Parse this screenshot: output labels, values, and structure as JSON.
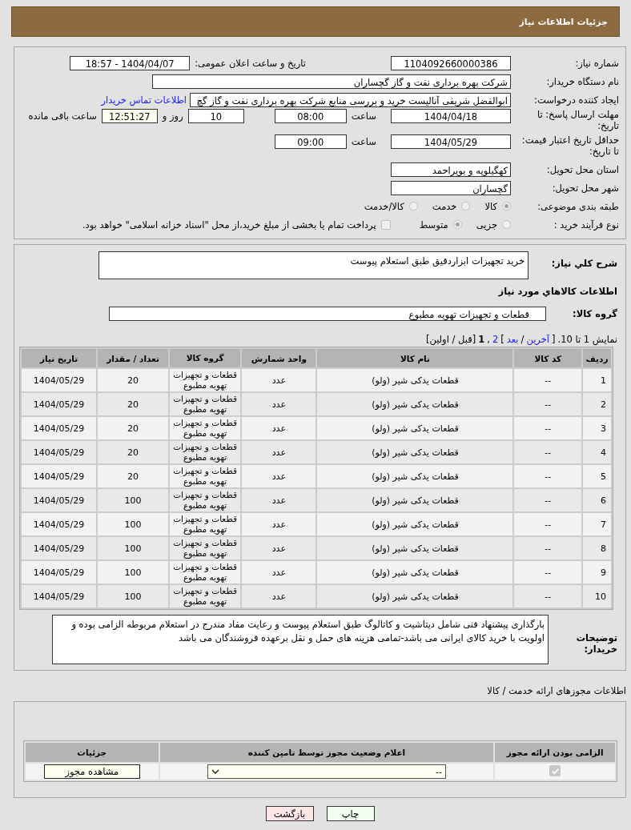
{
  "header": {
    "title": "جزئیات اطلاعات نیاز"
  },
  "form": {
    "need_number": {
      "label": "شماره نیاز:",
      "value": "1104092660000386"
    },
    "announce": {
      "label": "تاریخ و ساعت اعلان عمومی:",
      "value": "1404/04/07 - 18:57"
    },
    "buyer": {
      "label": "نام دستگاه خریدار:",
      "value": "شرکت بهره برداری نفت و گاز گچساران"
    },
    "creator": {
      "label": "ایجاد کننده درخواست:",
      "value": "ابوالفضل شریفی آنالیست خرید و بررسی منابع شرکت بهره برداری نفت و گاز گچ",
      "link": "اطلاعات تماس خریدار"
    },
    "deadline": {
      "label": "مهلت ارسال پاسخ: تا تاریخ:",
      "date": "1404/04/18",
      "time_label": "ساعت",
      "time": "08:00",
      "days": "10",
      "days_label": "روز و",
      "remaining": "12:51:27",
      "remaining_label": "ساعت باقی مانده"
    },
    "validity": {
      "label": "حداقل تاریخ اعتبار قیمت: تا تاریخ:",
      "date": "1404/05/29",
      "time_label": "ساعت",
      "time": "09:00"
    },
    "province": {
      "label": "استان محل تحویل:",
      "value": "کهگیلویه و بویراحمد"
    },
    "city": {
      "label": "شهر محل تحویل:",
      "value": "گچساران"
    },
    "category": {
      "label": "طبقه بندی موضوعی:",
      "options": [
        {
          "label": "کالا",
          "selected": true
        },
        {
          "label": "خدمت",
          "selected": false
        },
        {
          "label": "کالا/خدمت",
          "selected": false
        }
      ]
    },
    "process": {
      "label": "نوع فرآیند خرید :",
      "options": [
        {
          "label": "جزیی",
          "selected": false
        },
        {
          "label": "متوسط",
          "selected": true
        }
      ],
      "payment": {
        "label": "پرداخت تمام یا بخشی از مبلغ خرید،از محل \"اسناد خزانه اسلامی\" خواهد بود.",
        "checked": false
      }
    }
  },
  "summary": {
    "label": "شرح کلي نياز:",
    "value": "خرید تجهیزات ابزاردقیق طبق استعلام پیوست"
  },
  "goods_title": "اطلاعات کالاهاي مورد نياز",
  "goods_group": {
    "label": "گروه کالا:",
    "value": "قطعات و تجهیزات تهویه مطبوع"
  },
  "pagination": [
    {
      "kind": "text",
      "text": "نمایش 1 تا 10."
    },
    {
      "kind": "text",
      "text": "["
    },
    {
      "kind": "link",
      "text": "آخرین"
    },
    {
      "kind": "text",
      "text": "/"
    },
    {
      "kind": "link",
      "text": "بعد"
    },
    {
      "kind": "text",
      "text": "]"
    },
    {
      "kind": "link",
      "text": "2"
    },
    {
      "kind": "text",
      "text": ","
    },
    {
      "kind": "current",
      "text": "1"
    },
    {
      "kind": "text",
      "text": "[قبل / اولین]"
    }
  ],
  "table": {
    "columns": [
      "ردیف",
      "کد کالا",
      "نام کالا",
      "واحد شمارش",
      "گروه کالا",
      "تعداد / مقدار",
      "تاریخ نیاز"
    ],
    "rows": [
      [
        "1",
        "--",
        "قطعات یدکی شیر (ولو)",
        "عدد",
        "قطعات و تجهیزات تهویه مطبوع",
        "20",
        "1404/05/29"
      ],
      [
        "2",
        "--",
        "قطعات یدکی شیر (ولو)",
        "عدد",
        "قطعات و تجهیزات تهویه مطبوع",
        "20",
        "1404/05/29"
      ],
      [
        "3",
        "--",
        "قطعات یدکی شیر (ولو)",
        "عدد",
        "قطعات و تجهیزات تهویه مطبوع",
        "20",
        "1404/05/29"
      ],
      [
        "4",
        "--",
        "قطعات یدکی شیر (ولو)",
        "عدد",
        "قطعات و تجهیزات تهویه مطبوع",
        "20",
        "1404/05/29"
      ],
      [
        "5",
        "--",
        "قطعات یدکی شیر (ولو)",
        "عدد",
        "قطعات و تجهیزات تهویه مطبوع",
        "20",
        "1404/05/29"
      ],
      [
        "6",
        "--",
        "قطعات یدکی شیر (ولو)",
        "عدد",
        "قطعات و تجهیزات تهویه مطبوع",
        "100",
        "1404/05/29"
      ],
      [
        "7",
        "--",
        "قطعات یدکی شیر (ولو)",
        "عدد",
        "قطعات و تجهیزات تهویه مطبوع",
        "100",
        "1404/05/29"
      ],
      [
        "8",
        "--",
        "قطعات یدکی شیر (ولو)",
        "عدد",
        "قطعات و تجهیزات تهویه مطبوع",
        "100",
        "1404/05/29"
      ],
      [
        "9",
        "--",
        "قطعات یدکی شیر (ولو)",
        "عدد",
        "قطعات و تجهیزات تهویه مطبوع",
        "100",
        "1404/05/29"
      ],
      [
        "10",
        "--",
        "قطعات یدکی شیر (ولو)",
        "عدد",
        "قطعات و تجهیزات تهویه مطبوع",
        "100",
        "1404/05/29"
      ]
    ]
  },
  "buyer_notes": {
    "label": "توضیحات خریدار:",
    "value": "بارگذاری پیشنهاد فنی شامل دیتاشیت و کاتالوگ طبق استعلام پیوست و رعایت مفاد مندرج در استعلام مربوطه الزامی بوده و اولویت با خرید کالای ایرانی می باشد-تمامی هزینه های حمل و نقل برعهده فروشندگان می باشد"
  },
  "licenses": {
    "title": "اطلاعات مجوزهای ارائه خدمت / کالا",
    "columns": [
      "الزامی بودن ارائه مجوز",
      "اعلام وضعیت مجوز توسط تامین کننده",
      "جزئیات"
    ],
    "rows": [
      {
        "required": true,
        "status": "--",
        "details_button": "مشاهده مجوز"
      }
    ]
  },
  "buttons": [
    {
      "kind": "print",
      "label": "چاپ"
    },
    {
      "kind": "back",
      "label": "بازگشت"
    }
  ]
}
